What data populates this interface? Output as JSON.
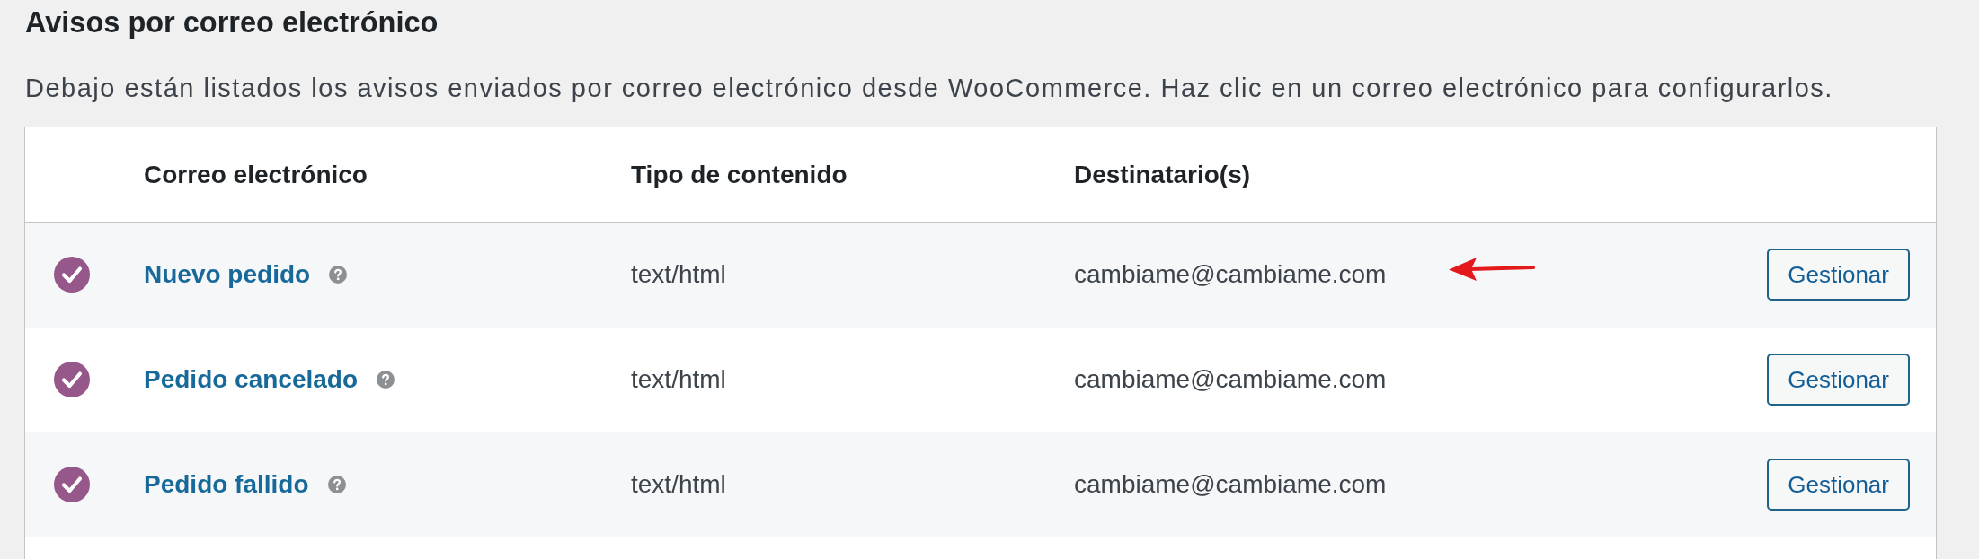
{
  "page": {
    "title": "Avisos por correo electrónico",
    "description": "Debajo están listados los avisos enviados por correo electrónico desde WooCommerce. Haz clic en un correo electrónico para configurarlos."
  },
  "table": {
    "columns": [
      "Correo electrónico",
      "Tipo de contenido",
      "Destinatario(s)"
    ],
    "rows": [
      {
        "enabled": true,
        "name": "Nuevo pedido",
        "content_type": "text/html",
        "recipient": "cambiame@cambiame.com",
        "action": "Gestionar",
        "pointed_at": true
      },
      {
        "enabled": true,
        "name": "Pedido cancelado",
        "content_type": "text/html",
        "recipient": "cambiame@cambiame.com",
        "action": "Gestionar",
        "pointed_at": false
      },
      {
        "enabled": true,
        "name": "Pedido fallido",
        "content_type": "text/html",
        "recipient": "cambiame@cambiame.com",
        "action": "Gestionar",
        "pointed_at": false
      }
    ]
  }
}
